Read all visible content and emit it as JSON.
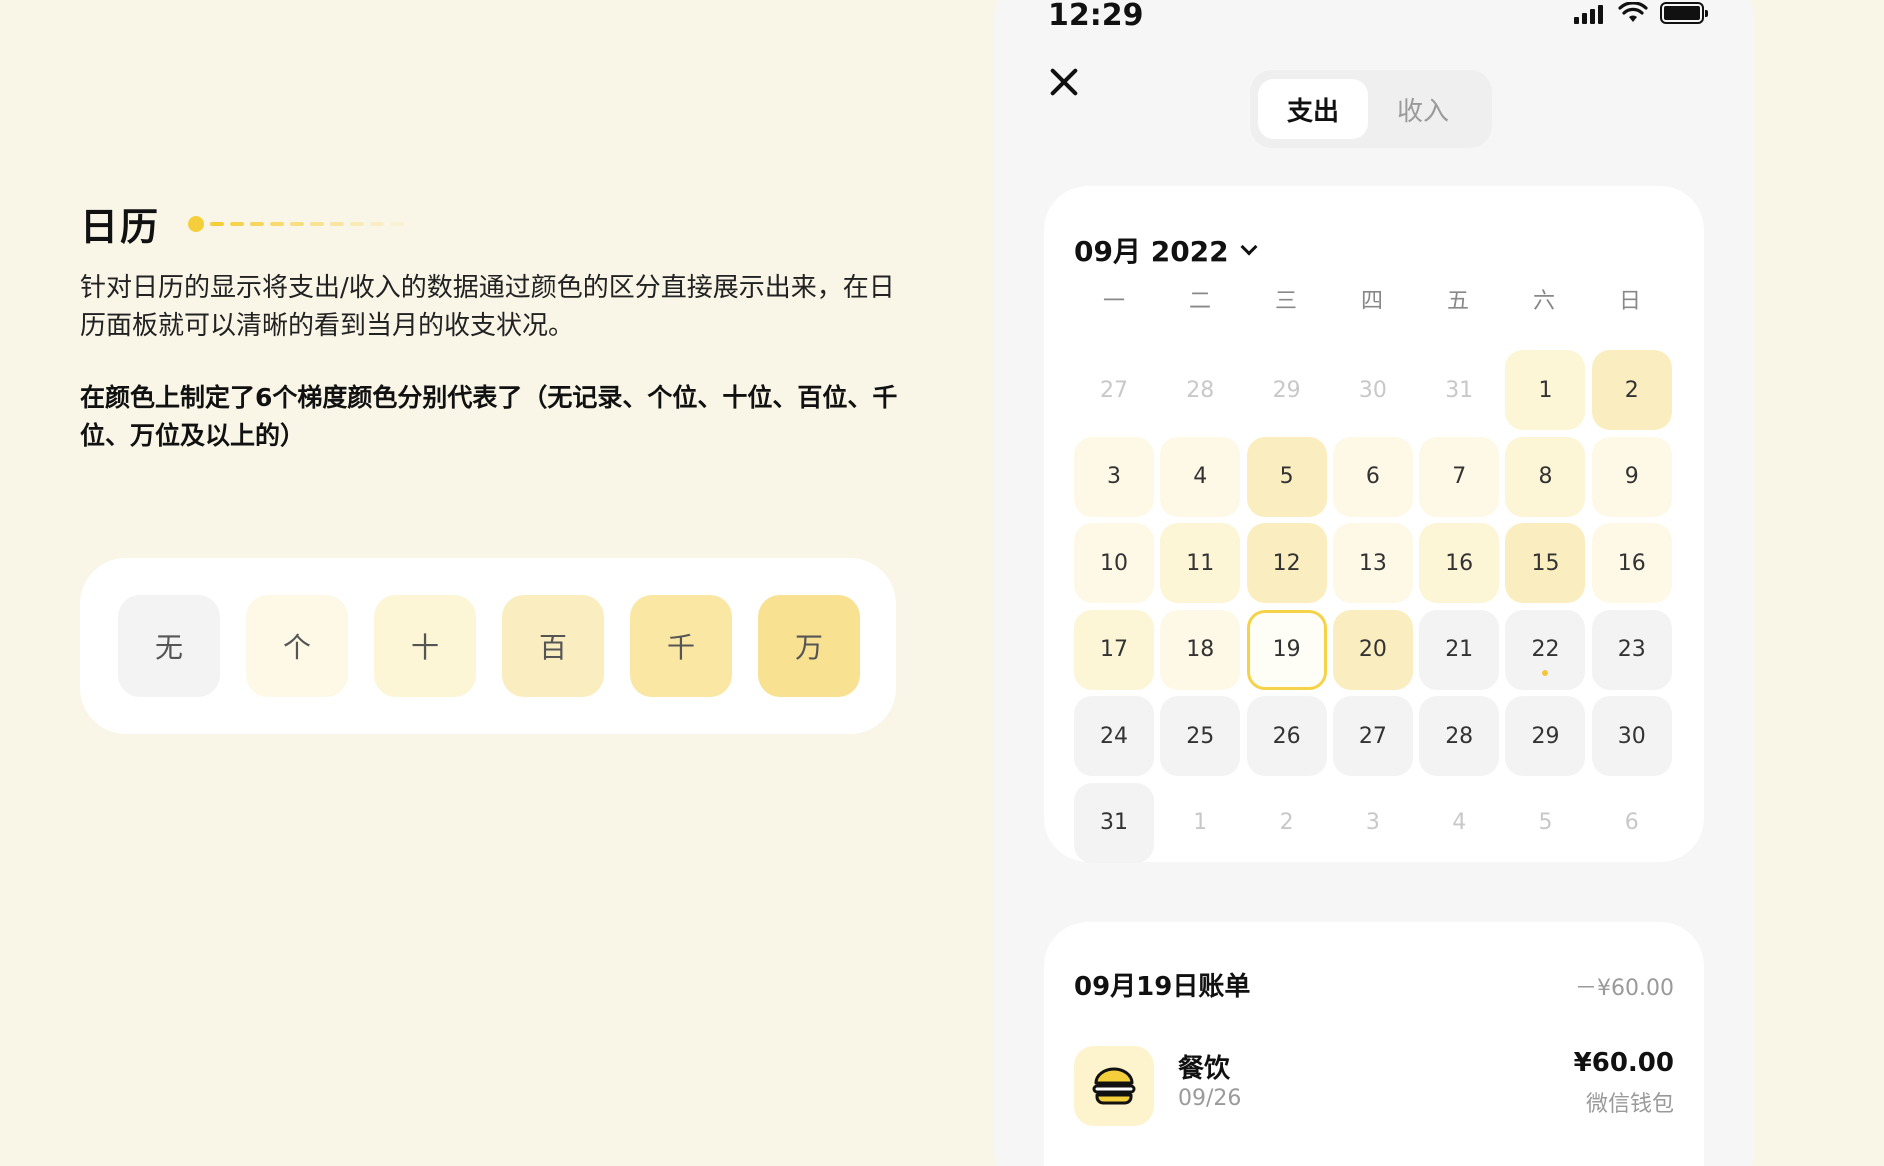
{
  "intro": {
    "title": "日历",
    "description": "针对日历的显示将支出/收入的数据通过颜色的区分直接展示出来，在日历面板就可以清晰的看到当月的收支状况。",
    "note": "在颜色上制定了6个梯度颜色分别代表了（无记录、个位、十位、百位、千位、万位及以上的）"
  },
  "legend": {
    "items": [
      {
        "label": "无",
        "color": "#f3f3f3"
      },
      {
        "label": "个",
        "color": "#fdf9e6"
      },
      {
        "label": "十",
        "color": "#fcf5d6"
      },
      {
        "label": "百",
        "color": "#faeec0"
      },
      {
        "label": "千",
        "color": "#fae7a4"
      },
      {
        "label": "万",
        "color": "#f9e192"
      }
    ]
  },
  "status_bar": {
    "time": "12:29"
  },
  "tabs": {
    "expense": "支出",
    "income": "收入",
    "active": "expense"
  },
  "calendar": {
    "month_label": "09月 2022",
    "weekdays": [
      "一",
      "二",
      "三",
      "四",
      "五",
      "六",
      "日"
    ],
    "days": [
      {
        "label": "27",
        "other": true,
        "level": -1
      },
      {
        "label": "28",
        "other": true,
        "level": -1
      },
      {
        "label": "29",
        "other": true,
        "level": -1
      },
      {
        "label": "30",
        "other": true,
        "level": -1
      },
      {
        "label": "31",
        "other": true,
        "level": -1
      },
      {
        "label": "1",
        "level": 2
      },
      {
        "label": "2",
        "level": 3
      },
      {
        "label": "3",
        "level": 1
      },
      {
        "label": "4",
        "level": 1
      },
      {
        "label": "5",
        "level": 3
      },
      {
        "label": "6",
        "level": 1
      },
      {
        "label": "7",
        "level": 1
      },
      {
        "label": "8",
        "level": 2
      },
      {
        "label": "9",
        "level": 1
      },
      {
        "label": "10",
        "level": 1
      },
      {
        "label": "11",
        "level": 2
      },
      {
        "label": "12",
        "level": 3
      },
      {
        "label": "13",
        "level": 1
      },
      {
        "label": "16",
        "level": 2
      },
      {
        "label": "15",
        "level": 3
      },
      {
        "label": "16",
        "level": 1
      },
      {
        "label": "17",
        "level": 2
      },
      {
        "label": "18",
        "level": 1
      },
      {
        "label": "19",
        "level": 1,
        "selected": true
      },
      {
        "label": "20",
        "level": 3
      },
      {
        "label": "21",
        "level": 0
      },
      {
        "label": "22",
        "level": 0,
        "mark": true
      },
      {
        "label": "23",
        "level": 0
      },
      {
        "label": "24",
        "level": 0
      },
      {
        "label": "25",
        "level": 0
      },
      {
        "label": "26",
        "level": 0
      },
      {
        "label": "27",
        "level": 0
      },
      {
        "label": "28",
        "level": 0
      },
      {
        "label": "29",
        "level": 0
      },
      {
        "label": "30",
        "level": 0
      },
      {
        "label": "31",
        "level": 0
      },
      {
        "label": "1",
        "other": true,
        "level": -1
      },
      {
        "label": "2",
        "other": true,
        "level": -1
      },
      {
        "label": "3",
        "other": true,
        "level": -1
      },
      {
        "label": "4",
        "other": true,
        "level": -1
      },
      {
        "label": "5",
        "other": true,
        "level": -1
      },
      {
        "label": "6",
        "other": true,
        "level": -1
      }
    ]
  },
  "bill": {
    "title": "09月19日账单",
    "total": "－¥60.00",
    "entry": {
      "icon": "burger-icon",
      "category": "餐饮",
      "date": "09/26",
      "amount": "¥60.00",
      "method": "微信钱包"
    }
  }
}
